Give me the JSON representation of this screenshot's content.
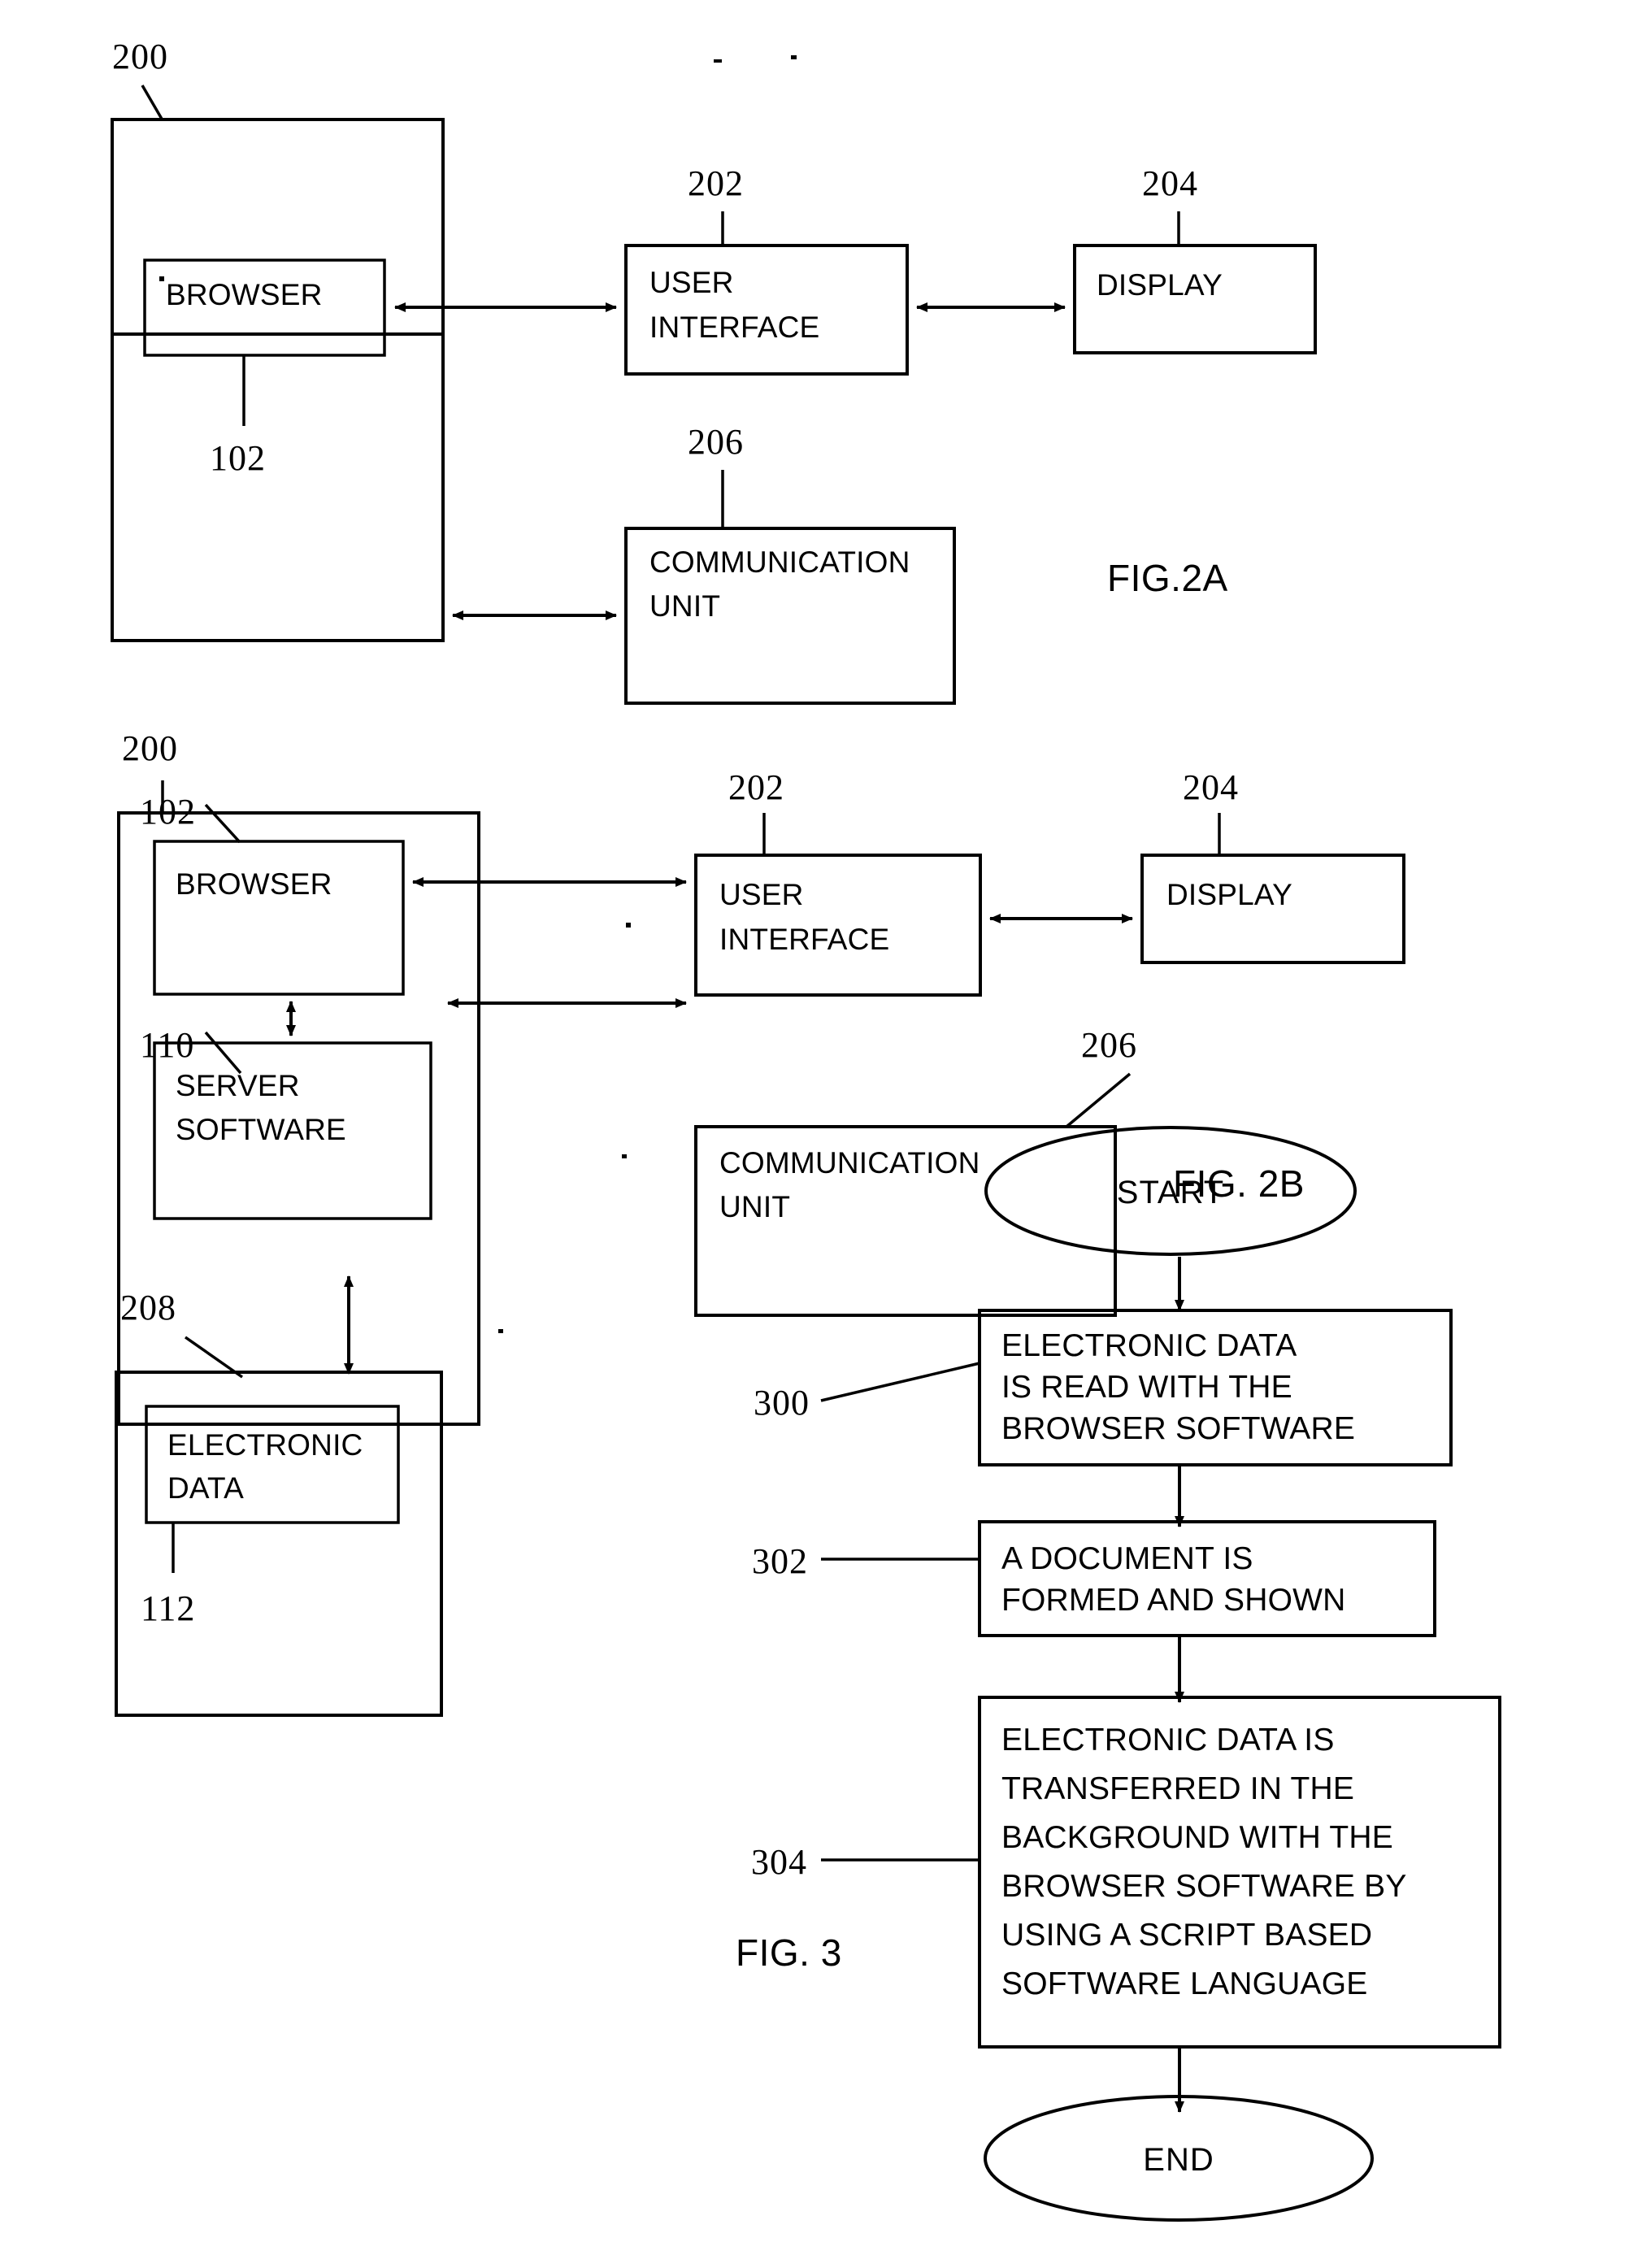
{
  "document": {
    "type": "patent-drawing-sheet",
    "figures": [
      "FIG.2A",
      "FIG. 2B",
      "FIG. 3"
    ]
  },
  "fig2a": {
    "caption": "FIG.2A",
    "ref_device": "200",
    "ref_browser": "102",
    "ref_user_interface": "202",
    "ref_display": "204",
    "ref_communication_unit": "206",
    "boxes": {
      "browser": "BROWSER",
      "user_interface_line1": "USER",
      "user_interface_line2": "INTERFACE",
      "display": "DISPLAY",
      "communication_unit_line1": "COMMUNICATION",
      "communication_unit_line2": "UNIT"
    }
  },
  "fig2b": {
    "caption": "FIG. 2B",
    "ref_device": "200",
    "ref_browser": "102",
    "ref_server_software": "110",
    "ref_user_interface": "202",
    "ref_display": "204",
    "ref_communication_unit": "206",
    "ref_data_store": "208",
    "ref_electronic_data": "112",
    "boxes": {
      "browser": "BROWSER",
      "server_software_line1": "SERVER",
      "server_software_line2": "SOFTWARE",
      "user_interface_line1": "USER",
      "user_interface_line2": "INTERFACE",
      "display": "DISPLAY",
      "communication_unit_line1": "COMMUNICATION",
      "communication_unit_line2": "UNIT",
      "electronic_data_line1": "ELECTRONIC",
      "electronic_data_line2": "DATA"
    }
  },
  "fig3": {
    "caption": "FIG. 3",
    "start_label": "START",
    "end_label": "END",
    "steps": [
      {
        "ref": "300",
        "lines": [
          "ELECTRONIC DATA",
          "IS READ WITH THE",
          "BROWSER SOFTWARE"
        ]
      },
      {
        "ref": "302",
        "lines": [
          "A DOCUMENT IS",
          "FORMED AND SHOWN"
        ]
      },
      {
        "ref": "304",
        "lines": [
          "ELECTRONIC DATA IS",
          "TRANSFERRED IN THE",
          "BACKGROUND WITH THE",
          "BROWSER SOFTWARE BY",
          "USING A SCRIPT BASED",
          "SOFTWARE LANGUAGE"
        ]
      }
    ]
  },
  "colors": {
    "ink": "#000000",
    "paper": "#ffffff"
  }
}
